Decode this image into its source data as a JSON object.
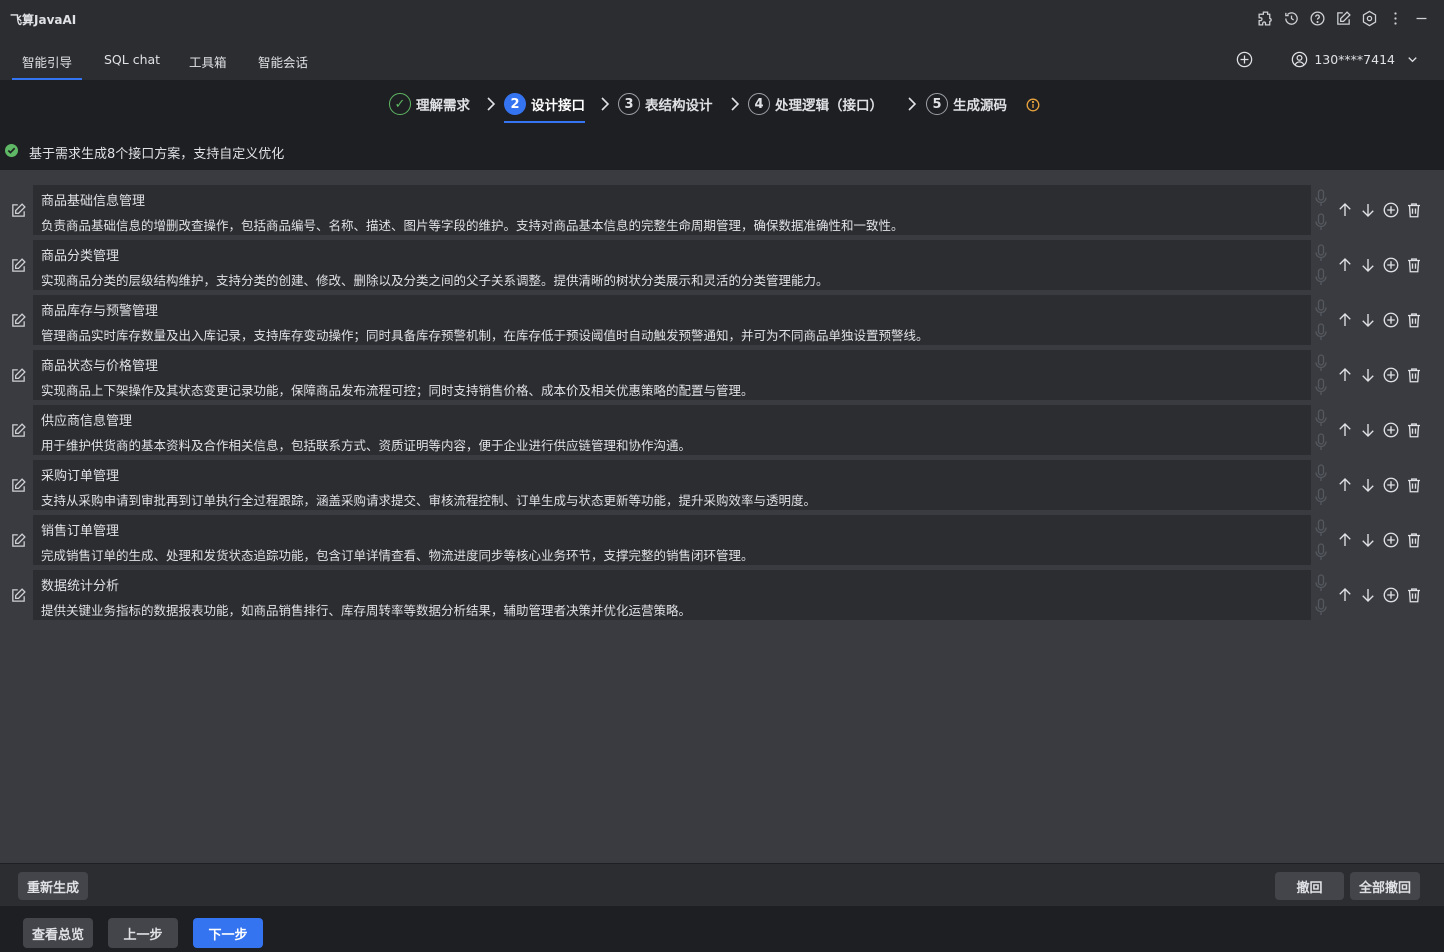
{
  "app": {
    "title": "飞算JavaAI"
  },
  "titlebar_icons": [
    "plugin-icon",
    "history-icon",
    "help-icon",
    "edit-note-icon",
    "settings-icon",
    "more-icon",
    "minimize-icon"
  ],
  "tabs": [
    {
      "label": "智能引导",
      "active": true
    },
    {
      "label": "SQL chat",
      "active": false
    },
    {
      "label": "工具箱",
      "active": false
    },
    {
      "label": "智能会话",
      "active": false
    }
  ],
  "user": {
    "id": "130****7414"
  },
  "steps": [
    {
      "number": "✓",
      "label": "理解需求",
      "state": "done"
    },
    {
      "number": "2",
      "label": "设计接口",
      "state": "current"
    },
    {
      "number": "3",
      "label": "表结构设计",
      "state": "pending"
    },
    {
      "number": "4",
      "label": "处理逻辑（接口）",
      "state": "pending"
    },
    {
      "number": "5",
      "label": "生成源码",
      "state": "pending"
    }
  ],
  "status": {
    "text": "基于需求生成8个接口方案，支持自定义优化",
    "color": "#5fb865"
  },
  "interfaces": [
    {
      "title": "商品基础信息管理",
      "desc": "负责商品基础信息的增删改查操作，包括商品编号、名称、描述、图片等字段的维护。支持对商品基本信息的完整生命周期管理，确保数据准确性和一致性。"
    },
    {
      "title": "商品分类管理",
      "desc": "实现商品分类的层级结构维护，支持分类的创建、修改、删除以及分类之间的父子关系调整。提供清晰的树状分类展示和灵活的分类管理能力。"
    },
    {
      "title": "商品库存与预警管理",
      "desc": "管理商品实时库存数量及出入库记录，支持库存变动操作；同时具备库存预警机制，在库存低于预设阈值时自动触发预警通知，并可为不同商品单独设置预警线。"
    },
    {
      "title": "商品状态与价格管理",
      "desc": "实现商品上下架操作及其状态变更记录功能，保障商品发布流程可控；同时支持销售价格、成本价及相关优惠策略的配置与管理。"
    },
    {
      "title": "供应商信息管理",
      "desc": "用于维护供货商的基本资料及合作相关信息，包括联系方式、资质证明等内容，便于企业进行供应链管理和协作沟通。"
    },
    {
      "title": "采购订单管理",
      "desc": "支持从采购申请到审批再到订单执行全过程跟踪，涵盖采购请求提交、审核流程控制、订单生成与状态更新等功能，提升采购效率与透明度。"
    },
    {
      "title": "销售订单管理",
      "desc": "完成销售订单的生成、处理和发货状态追踪功能，包含订单详情查看、物流进度同步等核心业务环节，支撑完整的销售闭环管理。"
    },
    {
      "title": "数据统计分析",
      "desc": "提供关键业务指标的数据报表功能，如商品销售排行、库存周转率等数据分析结果，辅助管理者决策并优化运营策略。"
    }
  ],
  "buttons": {
    "regenerate": "重新生成",
    "undo": "撤回",
    "undo_all": "全部撤回",
    "overview": "查看总览",
    "prev": "上一步",
    "next": "下一步"
  },
  "colors": {
    "accent": "#3574f0",
    "success": "#5fb865",
    "warning": "#e8a33d"
  }
}
